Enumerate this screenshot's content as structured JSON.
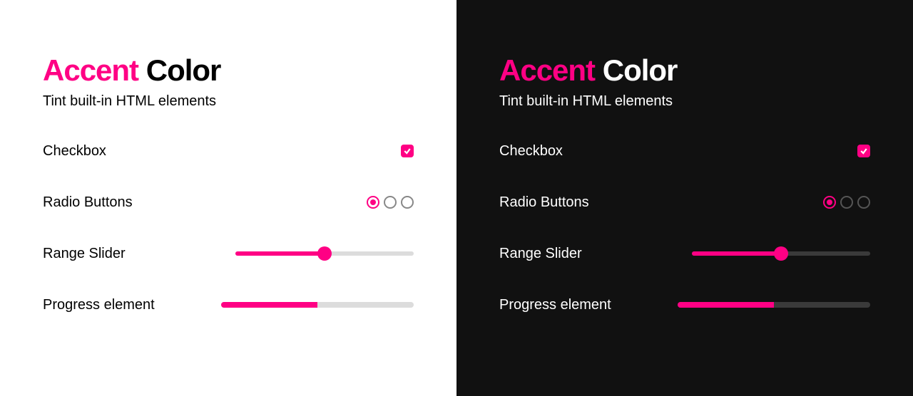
{
  "accent_color": "#ff0084",
  "title": {
    "accent_word": "Accent",
    "rest_word": "Color"
  },
  "subtitle": "Tint built-in HTML elements",
  "rows": {
    "checkbox": {
      "label": "Checkbox",
      "checked": true
    },
    "radio": {
      "label": "Radio Buttons",
      "selected_index": 0,
      "count": 3
    },
    "range": {
      "label": "Range Slider",
      "value": 50,
      "min": 0,
      "max": 100
    },
    "progress": {
      "label": "Progress element",
      "value": 50,
      "max": 100
    }
  }
}
